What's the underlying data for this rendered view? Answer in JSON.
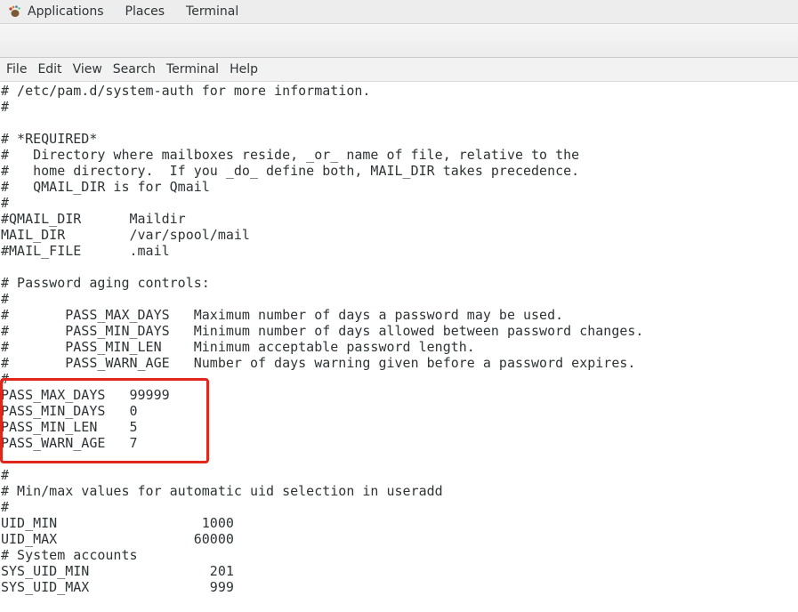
{
  "top_panel": {
    "applications": "Applications",
    "places": "Places",
    "terminal": "Terminal"
  },
  "menubar": {
    "file": "File",
    "edit": "Edit",
    "view": "View",
    "search": "Search",
    "terminal": "Terminal",
    "help": "Help"
  },
  "terminal": {
    "lines": [
      "# /etc/pam.d/system-auth for more information.",
      "#",
      "",
      "# *REQUIRED*",
      "#   Directory where mailboxes reside, _or_ name of file, relative to the",
      "#   home directory.  If you _do_ define both, MAIL_DIR takes precedence.",
      "#   QMAIL_DIR is for Qmail",
      "#",
      "#QMAIL_DIR      Maildir",
      "MAIL_DIR        /var/spool/mail",
      "#MAIL_FILE      .mail",
      "",
      "# Password aging controls:",
      "#",
      "#       PASS_MAX_DAYS   Maximum number of days a password may be used.",
      "#       PASS_MIN_DAYS   Minimum number of days allowed between password changes.",
      "#       PASS_MIN_LEN    Minimum acceptable password length.",
      "#       PASS_WARN_AGE   Number of days warning given before a password expires.",
      "#",
      "PASS_MAX_DAYS   99999",
      "PASS_MIN_DAYS   0",
      "PASS_MIN_LEN    5",
      "PASS_WARN_AGE   7",
      "",
      "#",
      "# Min/max values for automatic uid selection in useradd",
      "#",
      "UID_MIN                  1000",
      "UID_MAX                 60000",
      "# System accounts",
      "SYS_UID_MIN               201",
      "SYS_UID_MAX               999"
    ]
  },
  "colors": {
    "highlight": "#e1261c",
    "text": "#2e3436"
  }
}
